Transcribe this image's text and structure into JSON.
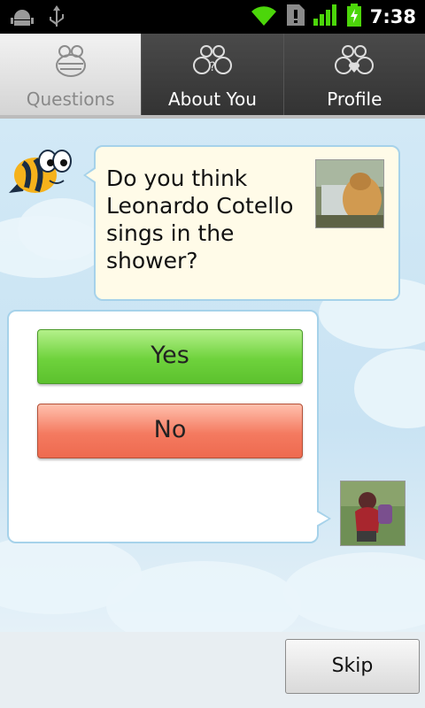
{
  "statusbar": {
    "time": "7:38"
  },
  "tabs": [
    {
      "label": "Questions"
    },
    {
      "label": "About You"
    },
    {
      "label": "Profile"
    }
  ],
  "question": {
    "text": "Do you think Leonardo Cotello sings in the shower?"
  },
  "answers": {
    "yes": "Yes",
    "no": "No"
  },
  "skip_label": "Skip",
  "colors": {
    "accent_blue": "#a6d2ea",
    "yes_green": "#6ed23c",
    "no_red": "#f47a60"
  }
}
